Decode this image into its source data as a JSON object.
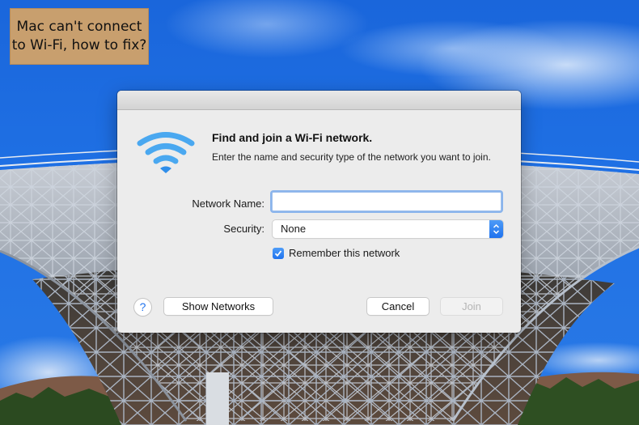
{
  "caption": {
    "line1": "Mac can't connect",
    "line2": "to Wi-Fi, how to fix?"
  },
  "dialog": {
    "icon": "wifi-icon",
    "heading": "Find and join a Wi-Fi network.",
    "description": "Enter the name and security type of the network you want to join.",
    "network_name": {
      "label": "Network Name:",
      "value": "",
      "placeholder": ""
    },
    "security": {
      "label": "Security:",
      "selected": "None"
    },
    "remember": {
      "label": "Remember this network",
      "checked": true
    },
    "buttons": {
      "help": "?",
      "show_networks": "Show Networks",
      "cancel": "Cancel",
      "join": "Join"
    }
  },
  "colors": {
    "accent": "#1f72ee",
    "wifi_icon": "#4aa8f0",
    "caption_bg": "#c89f6e",
    "sky": "#1f70e4"
  }
}
